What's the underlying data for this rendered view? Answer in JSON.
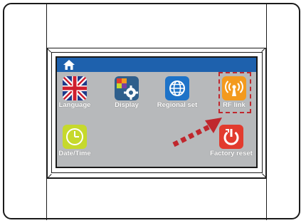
{
  "screen": {
    "topbar": {
      "home_icon": "home-icon",
      "color": "#1e61ad"
    },
    "background": "#b7b9bb",
    "tiles": [
      {
        "label": "Language",
        "icon": "uk-flag-icon"
      },
      {
        "label": "Display",
        "icon": "display-settings-icon",
        "color": "#2f5f8c"
      },
      {
        "label": "Regional set",
        "icon": "globe-icon",
        "color": "#1e73c8"
      },
      {
        "label": "RF link",
        "icon": "antenna-signal-icon",
        "color": "#f39a1e"
      },
      {
        "label": "Date/Time",
        "icon": "clock-icon",
        "color": "#c6d92c"
      },
      {
        "label": "Factory reset",
        "icon": "power-restart-icon",
        "color": "#e23b2e"
      }
    ]
  },
  "highlight": {
    "color": "#c0272d",
    "style": "dashed",
    "target": "RF link"
  }
}
